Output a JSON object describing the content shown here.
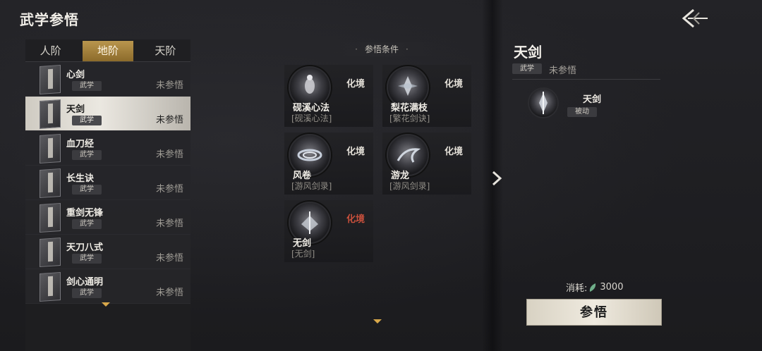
{
  "header": {
    "title": "武学参悟",
    "back_icon": "back-arrow-icon"
  },
  "tabs": [
    {
      "label": "人阶",
      "active": false
    },
    {
      "label": "地阶",
      "active": true
    },
    {
      "label": "天阶",
      "active": false
    }
  ],
  "skills": [
    {
      "name": "心剑",
      "tag": "武学",
      "status": "未参悟",
      "selected": false
    },
    {
      "name": "天剑",
      "tag": "武学",
      "status": "未参悟",
      "selected": true
    },
    {
      "name": "血刀经",
      "tag": "武学",
      "status": "未参悟",
      "selected": false
    },
    {
      "name": "长生诀",
      "tag": "武学",
      "status": "未参悟",
      "selected": false
    },
    {
      "name": "重剑无锋",
      "tag": "武学",
      "status": "未参悟",
      "selected": false
    },
    {
      "name": "天刀八式",
      "tag": "武学",
      "status": "未参悟",
      "selected": false
    },
    {
      "name": "剑心通明",
      "tag": "武学",
      "status": "未参悟",
      "selected": false
    }
  ],
  "conditions": {
    "header": "参悟条件",
    "items": [
      {
        "name": "砚溪心法",
        "sub": "[砚溪心法]",
        "realm": "化境",
        "realm_met": true
      },
      {
        "name": "梨花满枝",
        "sub": "[繁花剑诀]",
        "realm": "化境",
        "realm_met": true
      },
      {
        "name": "风卷",
        "sub": "[游风剑录]",
        "realm": "化境",
        "realm_met": true
      },
      {
        "name": "游龙",
        "sub": "[游风剑录]",
        "realm": "化境",
        "realm_met": true
      },
      {
        "name": "无剑",
        "sub": "[无剑]",
        "realm": "化境",
        "realm_met": false
      }
    ]
  },
  "detail": {
    "title": "天剑",
    "tag": "武学",
    "status": "未参悟",
    "passive": {
      "name": "天剑",
      "tag": "被动"
    },
    "cost_label": "消耗:",
    "cost_value": "3000",
    "button_label": "参悟"
  },
  "colors": {
    "accent_gold": "#b9964e",
    "unmet_red": "#c9503c"
  }
}
